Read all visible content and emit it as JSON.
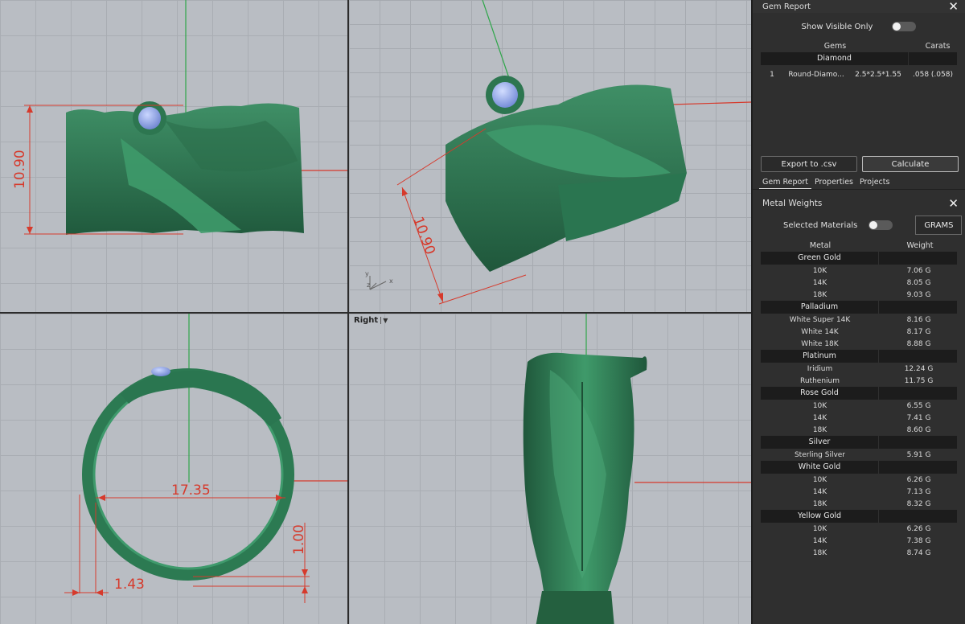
{
  "viewports": {
    "top_left": {
      "dim_height": "10.90"
    },
    "top_right": {
      "dim_height": "10.90",
      "axis_y": "y",
      "axis_x": "x",
      "axis_z": "z"
    },
    "bottom_left": {
      "dim_diameter": "17.35",
      "dim_thickness": "1.00",
      "dim_width": "1.43"
    },
    "bottom_right": {
      "label": "Right"
    }
  },
  "gem_report": {
    "title": "Gem Report",
    "show_visible_only": "Show Visible Only",
    "col_gems": "Gems",
    "col_carats": "Carats",
    "group": "Diamond",
    "row": {
      "num": "1",
      "name": "Round-Diamo...",
      "size": "2.5*2.5*1.55",
      "carats": ".058 (.058)"
    },
    "export_button": "Export to .csv",
    "calculate_button": "Calculate"
  },
  "tabs": [
    "Gem Report",
    "Properties",
    "Projects"
  ],
  "metal_weights": {
    "title": "Metal Weights",
    "selected_materials": "Selected Materials",
    "unit_button": "GRAMS",
    "col_metal": "Metal",
    "col_weight": "Weight",
    "groups": [
      {
        "name": "Green Gold",
        "items": [
          {
            "metal": "10K",
            "weight": "7.06 G"
          },
          {
            "metal": "14K",
            "weight": "8.05 G"
          },
          {
            "metal": "18K",
            "weight": "9.03 G"
          }
        ]
      },
      {
        "name": "Palladium",
        "items": [
          {
            "metal": "White Super 14K",
            "weight": "8.16 G"
          },
          {
            "metal": "White 14K",
            "weight": "8.17 G"
          },
          {
            "metal": "White 18K",
            "weight": "8.88 G"
          }
        ]
      },
      {
        "name": "Platinum",
        "items": [
          {
            "metal": "Iridium",
            "weight": "12.24 G"
          },
          {
            "metal": "Ruthenium",
            "weight": "11.75 G"
          }
        ]
      },
      {
        "name": "Rose Gold",
        "items": [
          {
            "metal": "10K",
            "weight": "6.55 G"
          },
          {
            "metal": "14K",
            "weight": "7.41 G"
          },
          {
            "metal": "18K",
            "weight": "8.60 G"
          }
        ]
      },
      {
        "name": "Silver",
        "items": [
          {
            "metal": "Sterling Silver",
            "weight": "5.91 G"
          }
        ]
      },
      {
        "name": "White Gold",
        "items": [
          {
            "metal": "10K",
            "weight": "6.26 G"
          },
          {
            "metal": "14K",
            "weight": "7.13 G"
          },
          {
            "metal": "18K",
            "weight": "8.32 G"
          }
        ]
      },
      {
        "name": "Yellow Gold",
        "items": [
          {
            "metal": "10K",
            "weight": "6.26 G"
          },
          {
            "metal": "14K",
            "weight": "7.38 G"
          },
          {
            "metal": "18K",
            "weight": "8.74 G"
          }
        ]
      }
    ]
  },
  "colors": {
    "ring_green": "#2f7a55",
    "dimension_red": "#d63a2c",
    "gem_blue": "#8fa6e6",
    "panel_bg": "#2f2f2f"
  }
}
